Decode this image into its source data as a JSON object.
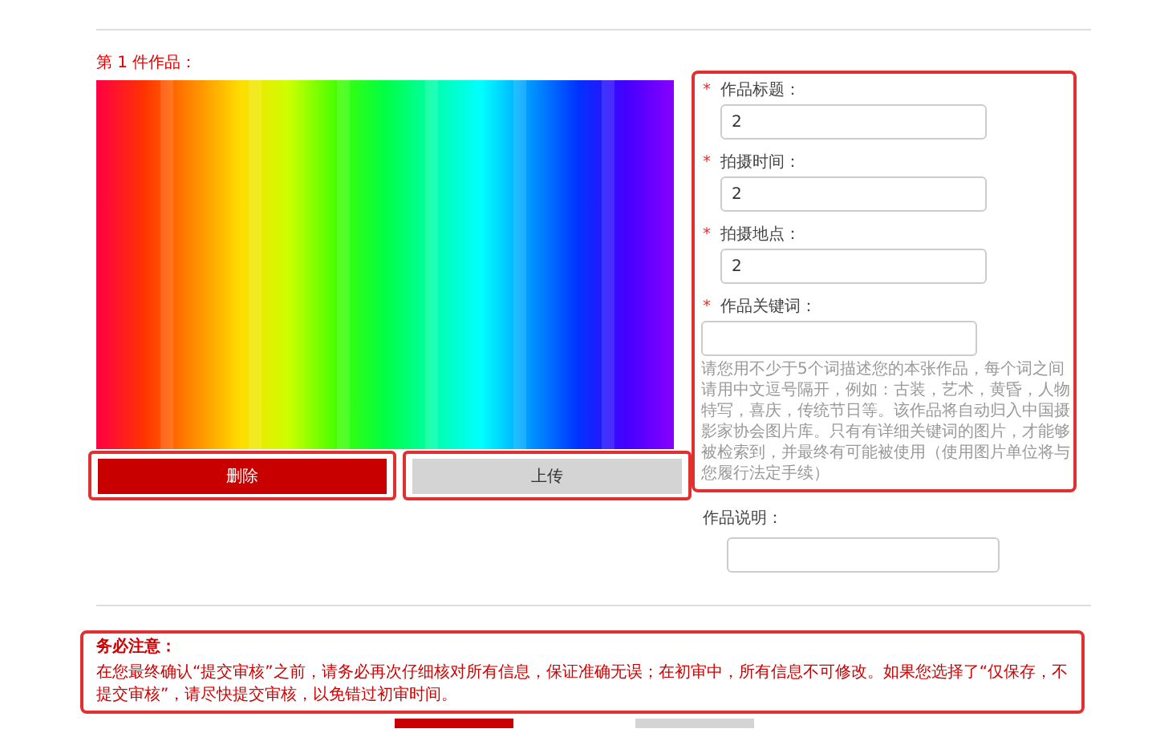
{
  "entry_heading": "第 1 件作品：",
  "buttons": [
    {
      "label": "删除",
      "kind": "danger",
      "highlighted": true
    },
    {
      "label": "上传",
      "kind": "plain",
      "highlighted": true
    }
  ],
  "form": {
    "highlighted": true,
    "required_mark": "*",
    "fields": [
      {
        "label": "作品标题：",
        "value": "2",
        "required": true
      },
      {
        "label": "拍摄时间：",
        "value": "2",
        "required": true
      },
      {
        "label": "拍摄地点：",
        "value": "2",
        "required": true
      },
      {
        "label": "作品关键词：",
        "required": true,
        "help": "请您用不少于5个词描述您的本张作品，每个词之间请用中文逗号隔开，例如：古装，艺术，黄昏，人物特写，喜庆，传统节日等。该作品将自动归入中国摄影家协会图片库。只有有详细关键词的图片，才能够被检索到，并最终有可能被使用（使用图片单位将与您履行法定手续）"
      }
    ]
  },
  "extra_field": {
    "label": "作品说明："
  },
  "notice": {
    "title": "务必注意：",
    "text": "在您最终确认“提交审核”之前，请务必再次仔细核对所有信息，保证准确无误；在初审中，所有信息不可修改。如果您选择了“仅保存，不提交审核”，请尽快提交审核，以免错过初审时间。",
    "highlighted": true
  },
  "bottom_buttons": [
    {
      "kind": "danger"
    },
    {
      "kind": "plain"
    }
  ]
}
